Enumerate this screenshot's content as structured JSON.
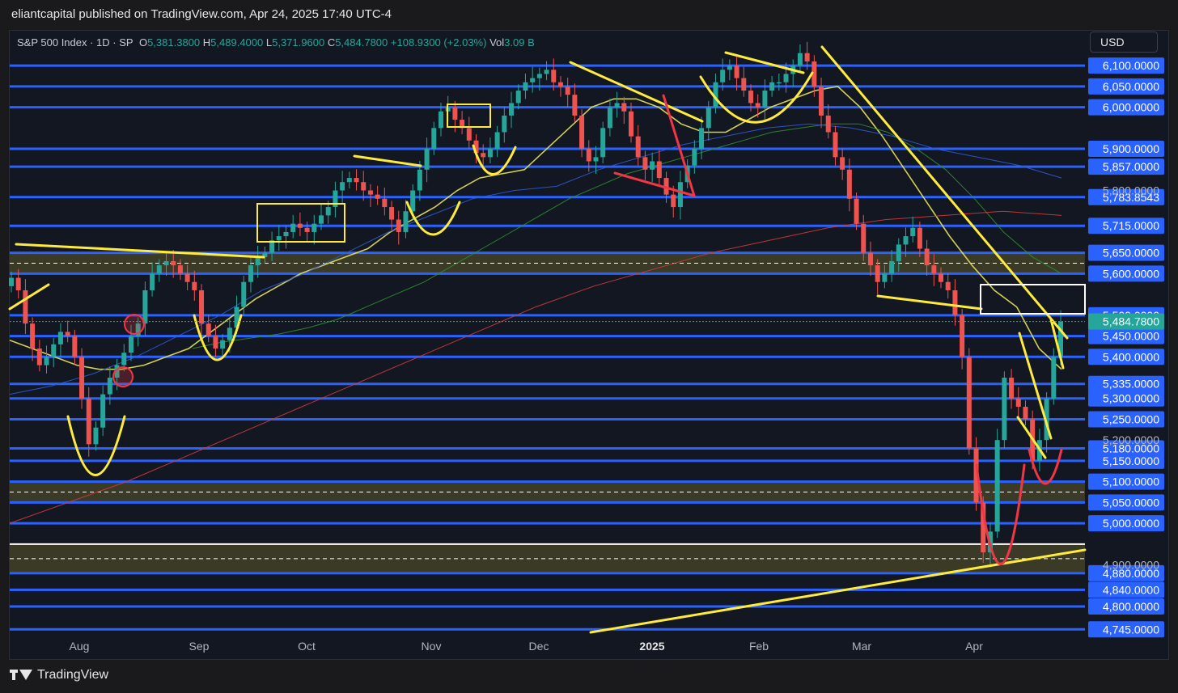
{
  "header": {
    "publisher": "eliantcapital published on TradingView.com, Apr 24, 2025 17:40 UTC-4"
  },
  "legend": {
    "symbol": "S&P 500 Index · 1D · SP",
    "o_label": "O",
    "o_value": "5,381.3800",
    "h_label": "H",
    "h_value": "5,489.4000",
    "l_label": "L",
    "l_value": "5,371.9600",
    "c_label": "C",
    "c_value": "5,484.7800",
    "change": "+108.9300 (+2.03%)",
    "vol_label": "Vol",
    "vol_value": "3.09 B"
  },
  "currency": "USD",
  "brand": "TradingView",
  "colors": {
    "up": "#26a69a",
    "down": "#ef5350",
    "level_line": "#2962ff",
    "drawing_yellow": "#ffeb3b",
    "drawing_red": "#f23645",
    "zone_fill": "#4d4a2a"
  },
  "chart_data": {
    "type": "line",
    "title": "S&P 500 Index · 1D · SP",
    "x_ticks": [
      "Aug",
      "Sep",
      "Oct",
      "Nov",
      "Dec",
      "2025",
      "Feb",
      "Mar",
      "Apr"
    ],
    "ylim": [
      4730,
      6180
    ],
    "price_levels": [
      6100,
      6050,
      6000,
      5900,
      5857,
      5783.8543,
      5715,
      5650,
      5600,
      5500,
      5450,
      5400,
      5335,
      5300,
      5250,
      5180,
      5150,
      5100,
      5050,
      5000,
      4880,
      4840,
      4800,
      4745
    ],
    "level_labels": [
      "6,100.0000",
      "6,050.0000",
      "6,000.0000",
      "5,900.0000",
      "5,857.0000",
      "5,783.8543",
      "5,715.0000",
      "5,650.0000",
      "5,600.0000",
      "5,500.0000",
      "5,450.0000",
      "5,400.0000",
      "5,335.0000",
      "5,300.0000",
      "5,250.0000",
      "5,180.0000",
      "5,150.0000",
      "5,100.0000",
      "5,050.0000",
      "5,000.0000",
      "4,880.0000",
      "4,840.0000",
      "4,800.0000",
      "4,745.0000"
    ],
    "axis_ticks": [
      "5,800.0000",
      "5,200.0000",
      "4,900.0000"
    ],
    "last_price": 5484.78,
    "last_price_label": "5,484.7800",
    "zones": [
      [
        5600,
        5650
      ],
      [
        5050,
        5100
      ],
      [
        4880,
        4950
      ]
    ],
    "series": [
      {
        "name": "Close",
        "values": [
          5590,
          5560,
          5480,
          5420,
          5380,
          5400,
          5430,
          5460,
          5450,
          5400,
          5300,
          5190,
          5230,
          5310,
          5350,
          5380,
          5410,
          5450,
          5480,
          5560,
          5600,
          5620,
          5630,
          5620,
          5600,
          5580,
          5560,
          5480,
          5450,
          5420,
          5440,
          5470,
          5520,
          5580,
          5620,
          5640,
          5650,
          5680,
          5690,
          5700,
          5720,
          5710,
          5700,
          5720,
          5740,
          5760,
          5800,
          5820,
          5830,
          5820,
          5800,
          5790,
          5780,
          5760,
          5730,
          5700,
          5750,
          5800,
          5850,
          5900,
          5950,
          5990,
          6000,
          5970,
          5950,
          5920,
          5890,
          5880,
          5900,
          5940,
          5980,
          6010,
          6040,
          6060,
          6070,
          6080,
          6090,
          6060,
          6050,
          6030,
          5980,
          5900,
          5870,
          5880,
          5950,
          6000,
          6010,
          5990,
          5930,
          5880,
          5850,
          5870,
          5830,
          5790,
          5760,
          5820,
          5860,
          5900,
          5950,
          6000,
          6060,
          6090,
          6100,
          6070,
          6040,
          6010,
          6000,
          6040,
          6060,
          6060,
          6080,
          6100,
          6130,
          6110,
          6050,
          5980,
          5940,
          5880,
          5850,
          5780,
          5720,
          5650,
          5620,
          5580,
          5600,
          5630,
          5670,
          5690,
          5710,
          5660,
          5620,
          5600,
          5580,
          5560,
          5500,
          5400,
          5180,
          5050,
          4930,
          4980,
          5200,
          5350,
          5300,
          5280,
          5250,
          5150,
          5200,
          5300,
          5400,
          5484.78
        ]
      },
      {
        "name": "",
        "values": [
          5440,
          5420,
          5400,
          5380,
          5370,
          5370,
          5380,
          5400,
          5420,
          5460,
          5500,
          5540,
          5570,
          5600,
          5620,
          5640,
          5660,
          5700,
          5730,
          5760,
          5800,
          5830,
          5840,
          5850,
          5900,
          5950,
          6000,
          6020,
          6020,
          6000,
          5960,
          5940,
          5940,
          5970,
          6000,
          6020,
          6040,
          6050,
          6000,
          5930,
          5850,
          5770,
          5690,
          5620,
          5560,
          5520,
          5420,
          5370
        ]
      },
      {
        "name": "",
        "values": [
          5420,
          5435,
          5445,
          5455,
          5470,
          5490,
          5520,
          5550,
          5580,
          5620,
          5660,
          5700,
          5740,
          5780,
          5810,
          5840,
          5860,
          5880,
          5900,
          5920,
          5940,
          5950,
          5960,
          5960,
          5940,
          5900,
          5850,
          5780,
          5700,
          5640,
          5600
        ]
      },
      {
        "name": "",
        "values": [
          5310,
          5330,
          5360,
          5400,
          5450,
          5500,
          5560,
          5600,
          5650,
          5700,
          5740,
          5780,
          5800,
          5810,
          5850,
          5880,
          5910,
          5930,
          5950,
          5960,
          5950,
          5930,
          5900,
          5880,
          5860,
          5830
        ]
      },
      {
        "name": "",
        "values": [
          5000,
          5050,
          5100,
          5160,
          5220,
          5280,
          5340,
          5400,
          5460,
          5520,
          5570,
          5610,
          5650,
          5680,
          5710,
          5730,
          5740,
          5750,
          5740
        ]
      }
    ]
  }
}
